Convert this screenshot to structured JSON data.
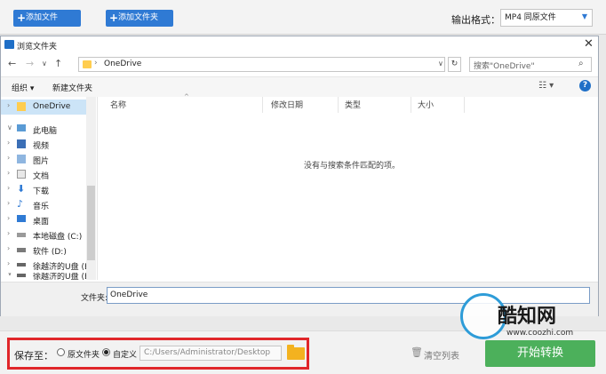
{
  "toolbar": {
    "add_file_label": "添加文件",
    "add_folder_label": "添加文件夹",
    "output_label": "输出格式：",
    "format_value": "MP4  同原文件"
  },
  "dialog": {
    "title": "浏览文件夹",
    "address": "OneDrive",
    "search_placeholder": "搜索\"OneDrive\"",
    "organize_label": "组织 ▾",
    "new_folder_label": "新建文件夹",
    "columns": [
      "名称",
      "修改日期",
      "类型",
      "大小"
    ],
    "empty_message": "没有与搜索条件匹配的项。",
    "tree": [
      {
        "label": "OneDrive",
        "icon": "folder-icon"
      },
      {
        "label": "此电脑",
        "icon": "computer-icon"
      },
      {
        "label": "视频",
        "icon": "video-icon"
      },
      {
        "label": "图片",
        "icon": "picture-icon"
      },
      {
        "label": "文档",
        "icon": "document-icon"
      },
      {
        "label": "下载",
        "icon": "download-icon"
      },
      {
        "label": "音乐",
        "icon": "music-icon"
      },
      {
        "label": "桌面",
        "icon": "desktop-icon"
      },
      {
        "label": "本地磁盘 (C:)",
        "icon": "drive-icon"
      },
      {
        "label": "软件 (D:)",
        "icon": "drive-icon"
      },
      {
        "label": "徐越济的U盘 (E:",
        "icon": "usb-icon"
      },
      {
        "label": "徐越济的U盘 (E:",
        "icon": "usb-icon"
      }
    ],
    "folder_label": "文件夹:",
    "folder_value": "OneDrive"
  },
  "bottom": {
    "save_to_label": "保存至：",
    "radio_original": "原文件夹",
    "radio_custom": "自定义",
    "path_value": "C:/Users/Administrator/Desktop",
    "clear_label": "清空列表",
    "start_label": "开始转换"
  },
  "watermark": {
    "title": "酷知网",
    "url": "www.coozhi.com"
  },
  "colors": {
    "accent": "#2f7ad4",
    "start": "#4cb05b",
    "highlight": "#e0262a"
  }
}
